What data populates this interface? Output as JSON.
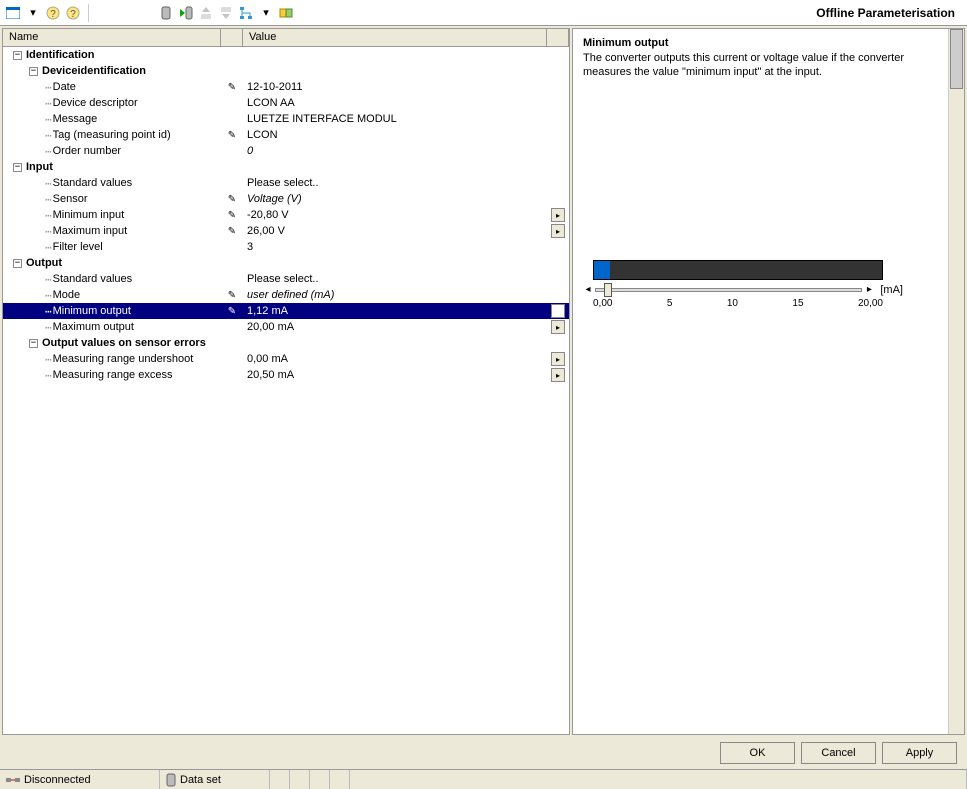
{
  "toolbar": {
    "mode": "Offline Parameterisation"
  },
  "columns": {
    "name": "Name",
    "value": "Value"
  },
  "tree": {
    "identification": "Identification",
    "devid": "Deviceidentification",
    "date_l": "Date",
    "date_v": "12-10-2011",
    "desc_l": "Device descriptor",
    "desc_v": "LCON AA",
    "msg_l": "Message",
    "msg_v": "LUETZE INTERFACE MODUL",
    "tag_l": "Tag (measuring point id)",
    "tag_v": "LCON",
    "ord_l": "Order number",
    "ord_v": "0",
    "input": "Input",
    "std_l": "Standard values",
    "std_v": "Please select..",
    "sensor_l": "Sensor",
    "sensor_v": "Voltage (V)",
    "minin_l": "Minimum input",
    "minin_v": "-20,80 V",
    "maxin_l": "Maximum input",
    "maxin_v": "26,00 V",
    "filt_l": "Filter level",
    "filt_v": "3",
    "output": "Output",
    "ostd_v": "Please select..",
    "mode_l": "Mode",
    "mode_v": "user defined (mA)",
    "minout_l": "Minimum output",
    "minout_v": "1,12 mA",
    "maxout_l": "Maximum output",
    "maxout_v": "20,00 mA",
    "err": "Output values on sensor errors",
    "under_l": "Measuring range undershoot",
    "under_v": "0,00 mA",
    "over_l": "Measuring range excess",
    "over_v": "20,50 mA"
  },
  "detail": {
    "title": "Minimum output",
    "desc": "The converter outputs this current or voltage value if the converter measures the value \"minimum input\" at the input.",
    "unit": "[mA]",
    "t0": "0,00",
    "t1": "5",
    "t2": "10",
    "t3": "15",
    "t4": "20,00"
  },
  "buttons": {
    "ok": "OK",
    "cancel": "Cancel",
    "apply": "Apply"
  },
  "status": {
    "conn": "Disconnected",
    "ds": "Data set"
  }
}
